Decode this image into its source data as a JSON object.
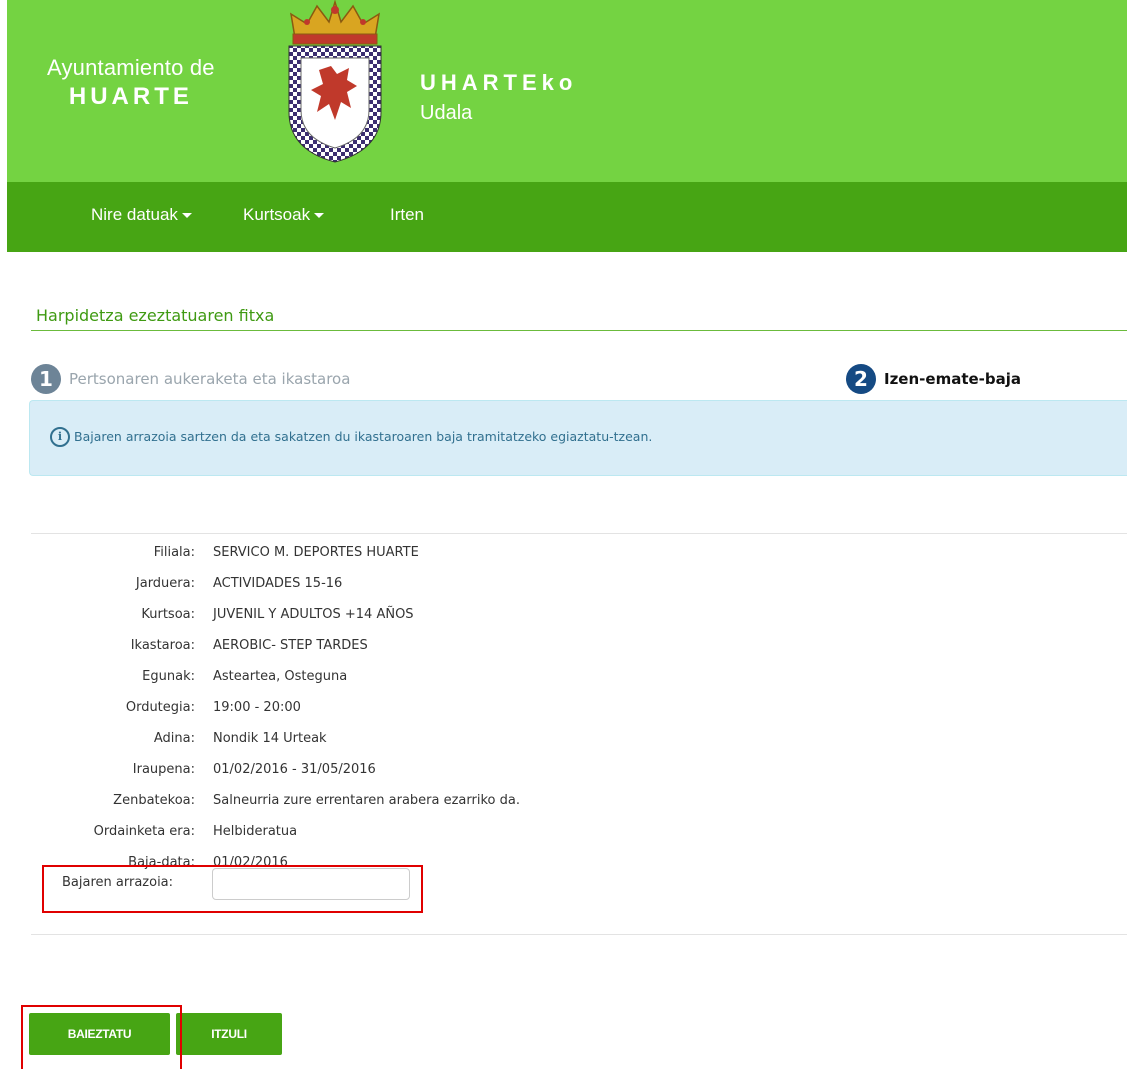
{
  "header": {
    "left_line1": "Ayuntamiento de",
    "left_line2": "HUARTE",
    "right_line1": "UHARTEko",
    "right_line2": "Udala",
    "emblem": "coat-of-arms-icon"
  },
  "nav": {
    "items": [
      {
        "label": "Nire datuak",
        "dropdown": true
      },
      {
        "label": "Kurtsoak",
        "dropdown": true
      },
      {
        "label": "Irten",
        "dropdown": false
      }
    ]
  },
  "page": {
    "title": "Harpidetza ezeztatuaren fitxa"
  },
  "steps": [
    {
      "number": "1",
      "label": "Pertsonaren aukeraketa eta ikastaroa",
      "active": false
    },
    {
      "number": "2",
      "label": "Izen-emate-baja",
      "active": true
    }
  ],
  "info": {
    "icon": "info-icon",
    "text": "Bajaren arrazoia sartzen da eta sakatzen du ikastaroaren baja tramitatzeko egiaztatu-tzean."
  },
  "details": [
    {
      "label": "Filiala:",
      "value": "SERVICO M. DEPORTES HUARTE"
    },
    {
      "label": "Jarduera:",
      "value": "ACTIVIDADES 15-16"
    },
    {
      "label": "Kurtsoa:",
      "value": "JUVENIL Y ADULTOS +14 AÑOS"
    },
    {
      "label": "Ikastaroa:",
      "value": "AEROBIC- STEP TARDES"
    },
    {
      "label": "Egunak:",
      "value": "Asteartea, Osteguna"
    },
    {
      "label": "Ordutegia:",
      "value": "19:00 - 20:00"
    },
    {
      "label": "Adina:",
      "value": "Nondik 14 Urteak"
    },
    {
      "label": "Iraupena:",
      "value": "01/02/2016 - 31/05/2016"
    },
    {
      "label": "Zenbatekoa:",
      "value": "Salneurria zure errentaren arabera ezarriko da."
    },
    {
      "label": "Ordainketa era:",
      "value": "Helbideratua"
    },
    {
      "label": "Baja-data:",
      "value": "01/02/2016"
    }
  ],
  "form": {
    "reason_label": "Bajaren arrazoia:",
    "reason_value": "",
    "confirm_button": "BAIEZTATU",
    "back_button": "ITZULI"
  },
  "colors": {
    "header_green": "#74d342",
    "nav_green": "#47a514",
    "title_green": "#3f9a12",
    "info_bg": "#d9edf7",
    "step_active": "#154a83",
    "highlight_red": "#e00000"
  }
}
